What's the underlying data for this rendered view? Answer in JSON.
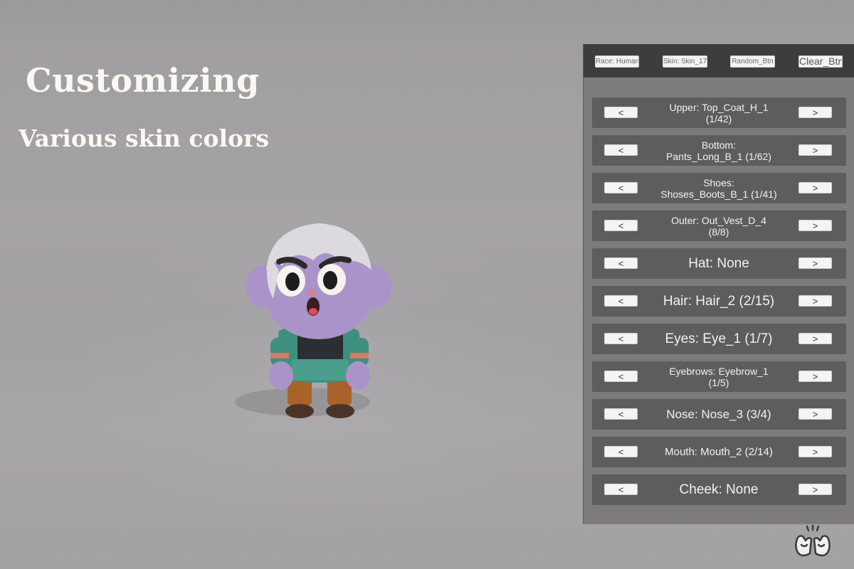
{
  "headline": "Customizing",
  "subheadline": "Various skin colors",
  "character": {
    "skin_color": "#a993c9",
    "hair_color": "#dcdadf",
    "coat_color": "#3f8f80",
    "pants_color": "#b0692d"
  },
  "toolbar": {
    "race_label": "Race: Human",
    "skin_label": "Skin: Skin_17",
    "random_label": "Random_Btn",
    "clear_label": "Clear_Btn"
  },
  "controls": {
    "prev_label": "<",
    "next_label": ">",
    "rows": [
      {
        "label": "Upper: Top_Coat_H_1\n(1/42)"
      },
      {
        "label": "Bottom:\nPants_Long_B_1  (1/62)"
      },
      {
        "label": "Shoes:\nShoses_Boots_B_1  (1/41)"
      },
      {
        "label": "Outer: Out_Vest_D_4\n(8/8)"
      },
      {
        "label": "Hat: None"
      },
      {
        "label": "Hair: Hair_2  (2/15)"
      },
      {
        "label": "Eyes: Eye_1  (1/7)"
      },
      {
        "label": "Eyebrows: Eyebrow_1\n(1/5)"
      },
      {
        "label": "Nose: Nose_3  (3/4)"
      },
      {
        "label": "Mouth: Mouth_2  (2/14)"
      },
      {
        "label": "Cheek: None"
      }
    ]
  },
  "logo_icon": "hands-logo-icon"
}
